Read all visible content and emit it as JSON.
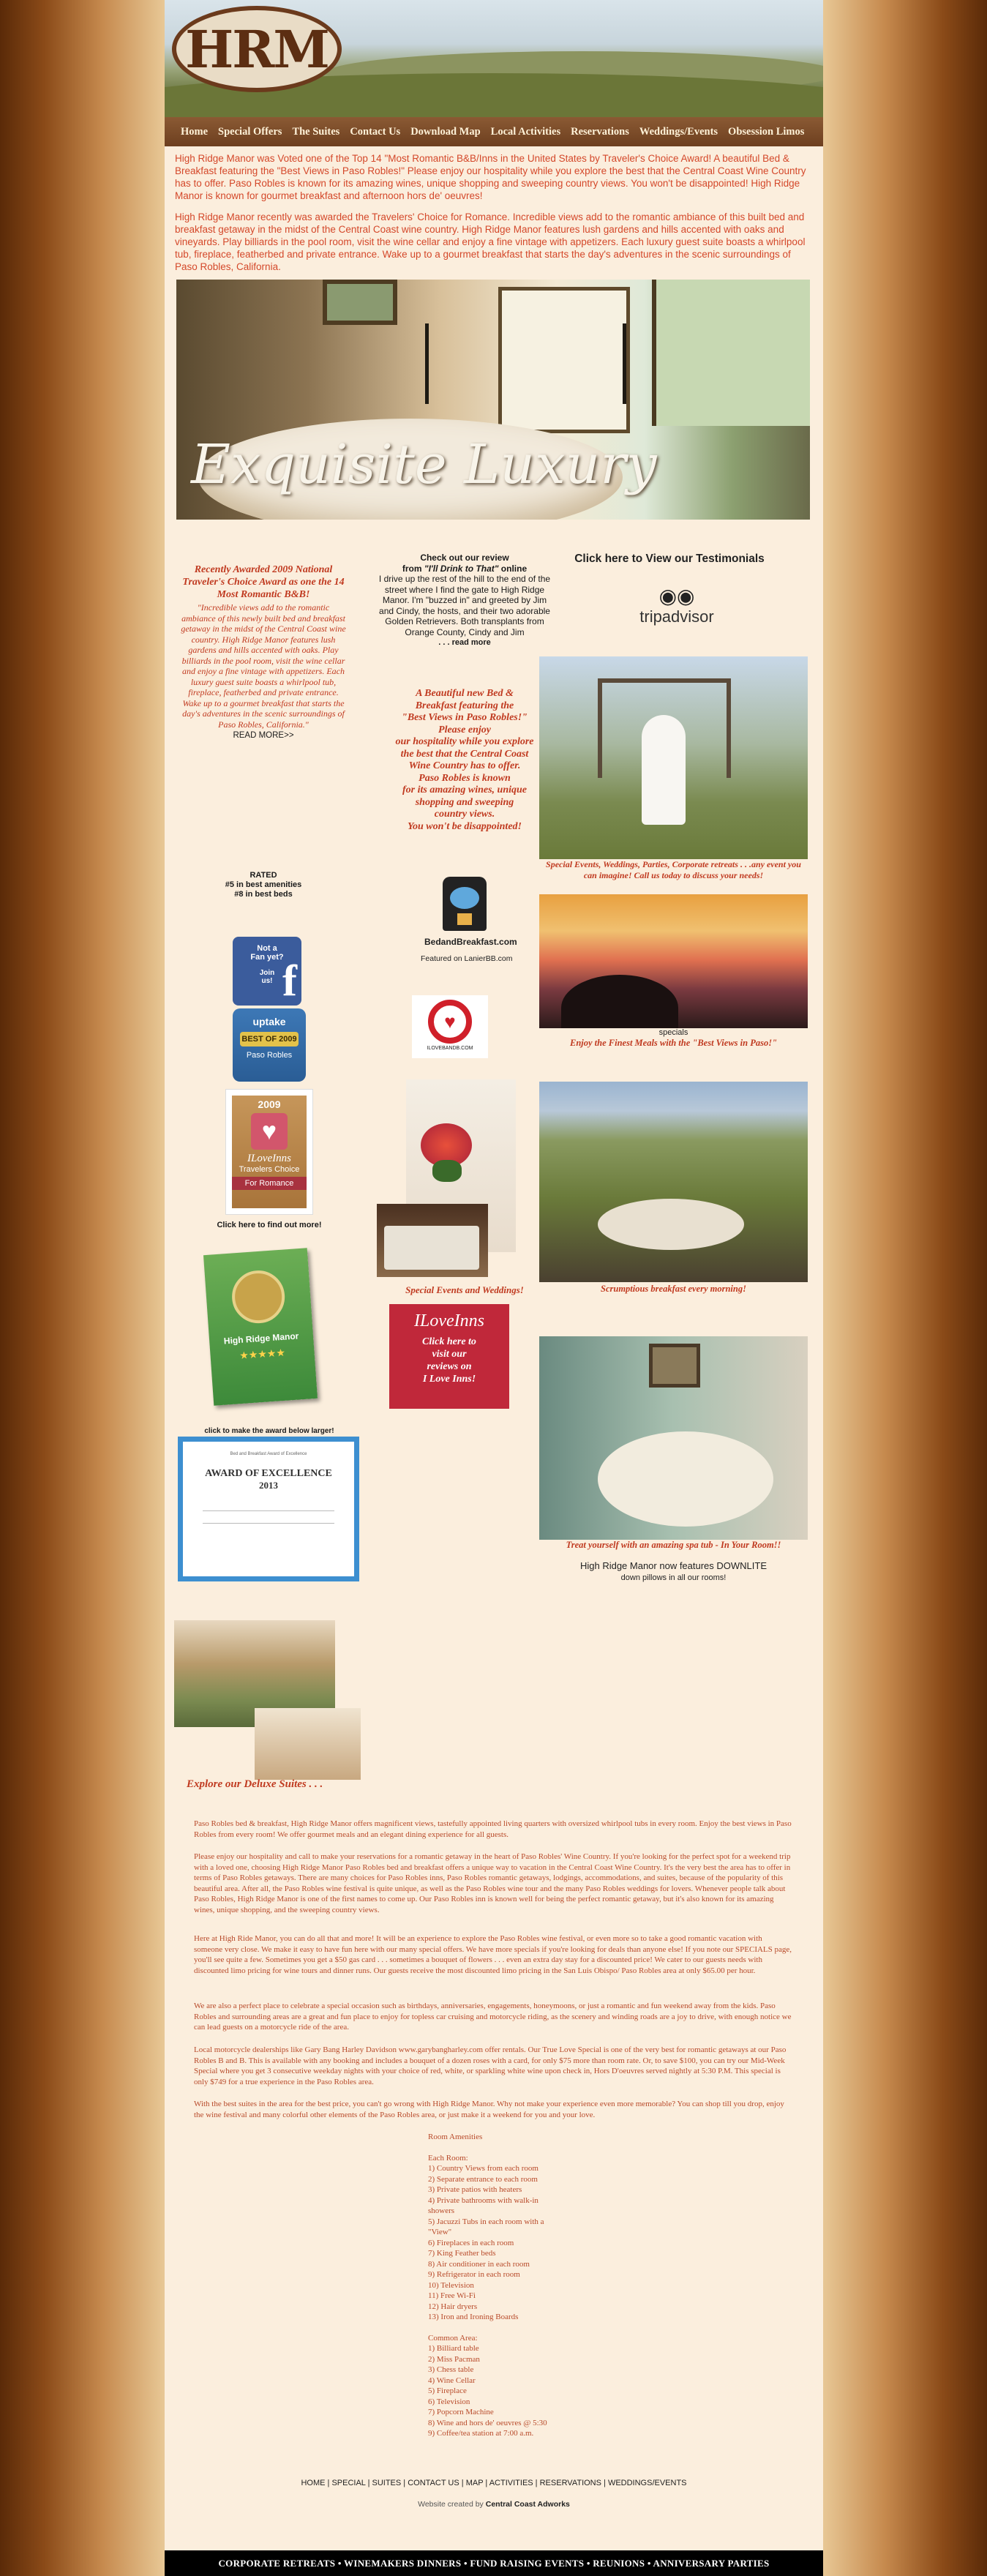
{
  "header": {
    "logo_text": "HRM",
    "nav": [
      "Home",
      "Special Offers",
      "The Suites",
      "Contact Us",
      "Download Map",
      "Local Activities",
      "Reservations",
      "Weddings/Events",
      "Obsession Limos"
    ]
  },
  "intro": {
    "p1": "High Ridge Manor was Voted one of the Top 14 \"Most Romantic B&B/Inns in the United States by Traveler's Choice Award! A beautiful Bed & Breakfast featuring the \"Best Views in Paso Robles!\" Please enjoy our hospitality while you explore the best that the Central Coast Wine Country has to offer. Paso Robles is known for its amazing wines, unique shopping and sweeping country views. You won't be disappointed! High Ridge Manor is known for gourmet breakfast and afternoon hors de' oeuvres!",
    "p2": "High Ridge Manor recently was awarded the Travelers' Choice for Romance. Incredible views add to the romantic ambiance of this built bed and breakfast getaway in the midst of the Central Coast wine country. High Ridge Manor features lush gardens and hills accented with oaks and vineyards. Play billiards in the pool room, visit the wine cellar and enjoy a fine vintage with appetizers. Each luxury guest suite boasts a whirlpool tub, fireplace, featherbed and private entrance. Wake up to a gourmet breakfast that starts the day's adventures in the scenic surroundings of Paso Robles, California."
  },
  "hero": {
    "title": "Exquisite Luxury"
  },
  "left_col": {
    "award_title": "Recently Awarded 2009 National Traveler's Choice Award as one the 14 Most Romantic B&B!",
    "award_body": "\"Incredible views add to the romantic ambiance of this newly built bed and breakfast getaway in the midst of the Central Coast wine country. High Ridge Manor features lush gardens and hills accented with oaks. Play billiards in the pool room, visit the wine cellar and enjoy a fine vintage with appetizers. Each luxury guest suite boasts a whirlpool tub, fireplace, featherbed and private entrance. Wake up to a gourmet breakfast that starts the day's adventures in the scenic surroundings of Paso Robles, California.\"",
    "read_more": "READ MORE>>",
    "rated_title": "RATED",
    "rated_1": "#5 in best amenities",
    "rated_2": "#8 in best beds",
    "fb_1": "Not a",
    "fb_2": "Fan yet?",
    "fb_3": "Join",
    "fb_4": "us!",
    "uptake_1": "uptake",
    "uptake_2": "BEST OF 2009",
    "uptake_3": "Paso Robles",
    "iloveinns_year": "2009",
    "iloveinns_brand": "ILoveInns",
    "iloveinns_tc": "Travelers Choice",
    "iloveinns_for": "For Romance",
    "click_find": "Click here to find out more!",
    "book_title": "High Ridge Manor",
    "click_award": "click to make the award below larger!",
    "cert_head": "Bed and Breakfast Award of Excellence",
    "cert_title": "AWARD OF EXCELLENCE",
    "cert_year": "2013"
  },
  "mid_col": {
    "review_head": "Check out our review",
    "review_from": "from",
    "review_title": "\"I'll Drink to That\"",
    "review_online": "online",
    "review_body": "I drive up the rest of the hill to the end of the street where I find the gate to High Ridge Manor. I'm \"buzzed in\" and greeted by Jim and Cindy, the hosts, and their two adorable Golden Retrievers. Both transplants from Orange County, Cindy and Jim",
    "review_more": ". . . read more",
    "bb_lines": [
      "A Beautiful new Bed &",
      "Breakfast featuring the",
      "\"Best Views in Paso Robles!\"",
      "Please enjoy",
      "our hospitality while you explore",
      "the best that the Central Coast",
      "Wine Country has to offer.",
      "Paso Robles is known",
      "for its amazing wines, unique",
      "shopping and sweeping",
      "country views.",
      "You won't be disappointed!"
    ],
    "bedbreakfast_brand": "BedandBreakfast.com",
    "lanier": "Featured on LanierBB.com",
    "ilovebb": "ILOVEBANDB.COM",
    "events_caption": "Special Events and Weddings!",
    "iloveinns_brand": "ILoveInns",
    "iloveinns_lines": [
      "Click here to",
      "visit our",
      "reviews on",
      "I Love Inns!"
    ]
  },
  "right_col": {
    "testimonials": "Click here to View our Testimonials",
    "tripadvisor": "tripadvisor",
    "wedding_caption": "Special Events, Weddings, Parties, Corporate retreats . . .any event you can imagine! Call us today to discuss your needs!",
    "specials": "specials",
    "meals": "Enjoy the Finest Meals with the \"Best Views in Paso!\"",
    "breakfast_caption": "Scrumptious breakfast every morning!",
    "spa_caption": "Treat yourself with an amazing spa tub - In Your Room!!",
    "downlite": "High Ridge Manor now features DOWNLITE",
    "downlite2": "down pillows in all our rooms!"
  },
  "suites": {
    "caption": "Explore our Deluxe Suites . . ."
  },
  "main_text": [
    "Paso Robles bed & breakfast, High Ridge Manor offers magnificent views, tastefully appointed living quarters with oversized whirlpool tubs in every room. Enjoy the best views in Paso Robles from every room! We offer gourmet meals and an elegant dining experience for all guests.",
    "Please enjoy our hospitality and call to make your reservations for a romantic getaway in the heart of Paso Robles' Wine Country. If you're looking for the perfect spot for a weekend trip with a loved one, choosing High Ridge Manor Paso Robles bed and breakfast offers a unique way to vacation in the Central Coast Wine Country. It's the very best the area has to offer in terms of Paso Robles getaways. There are many choices for Paso Robles inns, Paso Robles romantic getaways, lodgings, accommodations, and suites, because of the popularity of this beautiful area. After all, the Paso Robles wine festival is quite unique, as well as the Paso Robles wine tour and the many Paso Robles weddings for lovers. Whenever people talk about Paso Robles, High Ridge Manor is one of the first names to come up. Our Paso Robles inn is known well for being the perfect romantic getaway, but it's also known for its amazing wines, unique shopping, and the sweeping country views.",
    "Here at High Ride Manor, you can do all that and more! It will be an experience to explore the Paso Robles wine festival, or even more so to take a good romantic vacation with someone very close. We make it easy to have fun here with our many special offers. We have more specials if you're looking for deals than anyone else! If you note our SPECIALS page, you'll see quite a few. Sometimes you get a $50 gas card . . . sometimes a bouquet of flowers . . . even an extra day stay for a discounted price! We cater to our guests needs with discounted limo pricing for wine tours and dinner runs. Our guests receive the most discounted limo pricing in the San Luis Obispo/ Paso Robles area at only $65.00 per hour.",
    "We are also a perfect place to celebrate a special occasion such as birthdays, anniversaries, engagements, honeymoons, or just a romantic and fun weekend away from the kids. Paso Robles and surrounding areas are a great and fun place to enjoy for topless car cruising and motorcycle riding, as the scenery and winding roads are a joy to drive, with enough notice we can lead guests on a motorcycle ride of the area.",
    "Local motorcycle dealerships like Gary Bang Harley Davidson www.garybangharley.com offer rentals. Our True Love Special is one of the very best for romantic getaways at our Paso Robles B and B. This is available with any booking and includes a bouquet of a dozen roses with a card, for only $75 more than room rate. Or, to save $100, you can try our Mid-Week Special where you get 3 consecutive weekday nights with your choice of red, white, or sparkling white wine upon check in, Hors D'oeuvres served nightly at 5:30 P.M. This special is only $749 for a true experience in the Paso Robles area.",
    "With the best suites in the area for the best price, you can't go wrong with High Ridge Manor. Why not make your experience even more memorable? You can shop till you drop, enjoy the wine festival and many colorful other elements of the Paso Robles area, or just make it a weekend for you and your love."
  ],
  "amenities": {
    "title": "Room Amenities",
    "each_title": "Each Room:",
    "each": [
      "1) Country Views from each room",
      "2) Separate entrance to each room",
      "3) Private patios with heaters",
      "4) Private bathrooms with walk-in",
      "showers",
      "5) Jacuzzi Tubs in each room with a",
      "\"View\"",
      "6) Fireplaces in each room",
      "7) King Feather beds",
      "8) Air conditioner in each room",
      "9) Refrigerator in each room",
      "10) Television",
      "11) Free Wi-Fi",
      "12) Hair dryers",
      "13) Iron and Ironing Boards"
    ],
    "common_title": "Common Area:",
    "common": [
      "1) Billiard table",
      "2) Miss Pacman",
      "3) Chess table",
      "4) Wine Cellar",
      "5) Fireplace",
      "6) Television",
      "7) Popcorn Machine",
      "8) Wine and hors de' oeuvres @ 5:30",
      "9) Coffee/tea station at 7:00 a.m."
    ]
  },
  "footer": {
    "links": [
      "HOME",
      "SPECIAL",
      "SUITES",
      "CONTACT US",
      "MAP",
      "ACTIVITIES",
      "RESERVATIONS",
      "WEDDINGS/EVENTS"
    ],
    "credit_prefix": "Website created by",
    "credit_name": "Central Coast Adworks",
    "bar": "CORPORATE RETREATS • WINEMAKERS DINNERS • FUND RAISING EVENTS • REUNIONS • ANNIVERSARY PARTIES"
  }
}
